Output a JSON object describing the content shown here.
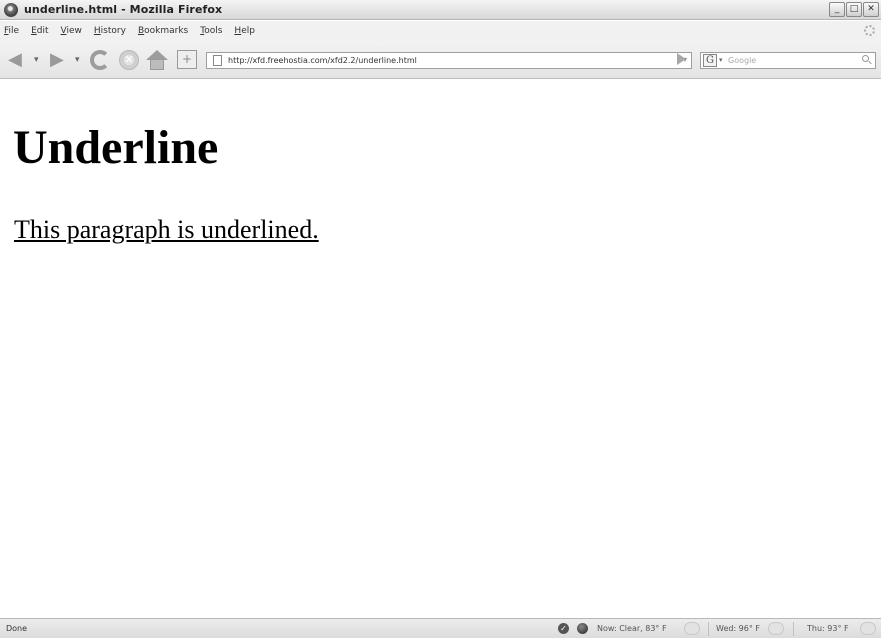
{
  "window": {
    "title": "underline.html - Mozilla Firefox",
    "controls": [
      "_",
      "□",
      "✕"
    ]
  },
  "menu": [
    {
      "label": "File",
      "key": "F",
      "rest": "ile"
    },
    {
      "label": "Edit",
      "key": "E",
      "rest": "dit"
    },
    {
      "label": "View",
      "key": "V",
      "rest": "iew"
    },
    {
      "label": "History",
      "key": "H",
      "rest": "istory"
    },
    {
      "label": "Bookmarks",
      "key": "B",
      "rest": "ookmarks"
    },
    {
      "label": "Tools",
      "key": "T",
      "rest": "ools"
    },
    {
      "label": "Help",
      "key": "H",
      "rest": "elp"
    }
  ],
  "toolbar": {
    "icons": [
      "back-icon",
      "forward-icon",
      "reload-icon",
      "stop-icon",
      "home-icon",
      "new-tab-icon",
      "go-icon"
    ],
    "url": "http://xfd.freehostia.com/xfd2.2/underline.html",
    "search_engine": "G",
    "search_placeholder": "Google"
  },
  "page": {
    "heading": "Underline",
    "paragraph": "This paragraph is underlined."
  },
  "status": {
    "text": "Done",
    "weather_now": "Now: Clear, 83° F",
    "weather_wed": "Wed: 96° F",
    "weather_thu": "Thu: 93° F"
  },
  "colors": {
    "chrome": "#e6e6e6",
    "page_background": "#ffffff",
    "text": "#000000"
  }
}
